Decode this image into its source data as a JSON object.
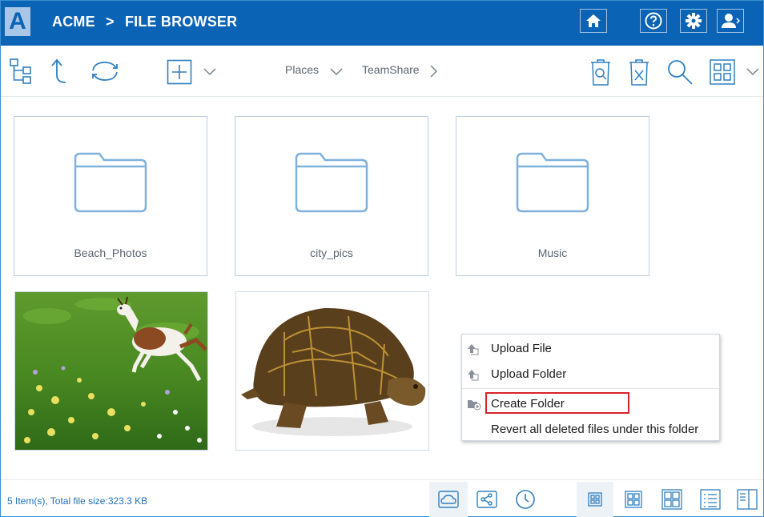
{
  "header": {
    "logo_letter": "A",
    "brand": "ACME",
    "separator": ">",
    "title": "FILE BROWSER",
    "icons": [
      "home-icon",
      "help-icon",
      "gear-icon",
      "user-icon"
    ]
  },
  "toolbar": {
    "places_label": "Places",
    "teamshare_label": "TeamShare",
    "icons": [
      "tree-view-icon",
      "up-folder-icon",
      "refresh-icon",
      "add-icon",
      "chevron-down-icon",
      "recycle-search-icon",
      "recycle-delete-icon",
      "search-icon",
      "grid-view-icon"
    ]
  },
  "items": [
    {
      "name": "Beach_Photos",
      "type": "folder"
    },
    {
      "name": "city_pics",
      "type": "folder"
    },
    {
      "name": "Music",
      "type": "folder"
    },
    {
      "name": "",
      "type": "image",
      "thumbnail": "goat-photo"
    },
    {
      "name": "",
      "type": "image",
      "thumbnail": "turtle-photo"
    }
  ],
  "context_menu": {
    "items": [
      {
        "label": "Upload File",
        "icon": "upload-icon"
      },
      {
        "label": "Upload Folder",
        "icon": "upload-icon"
      },
      {
        "label": "Create Folder",
        "icon": "new-folder-icon",
        "highlighted": true
      },
      {
        "label": "Revert all deleted files under this folder",
        "icon": ""
      }
    ]
  },
  "footer": {
    "status": "5 Item(s), Total file size:323.3 KB",
    "tabs": [
      "cloud-icon",
      "share-icon",
      "clock-icon"
    ],
    "views": [
      "small-grid-icon",
      "medium-grid-icon",
      "large-grid-icon",
      "list-icon",
      "preview-pane-icon"
    ]
  },
  "colors": {
    "header_bg": "#0a63b4",
    "accent": "#3b8fd0",
    "highlight_border": "#d8232a"
  }
}
